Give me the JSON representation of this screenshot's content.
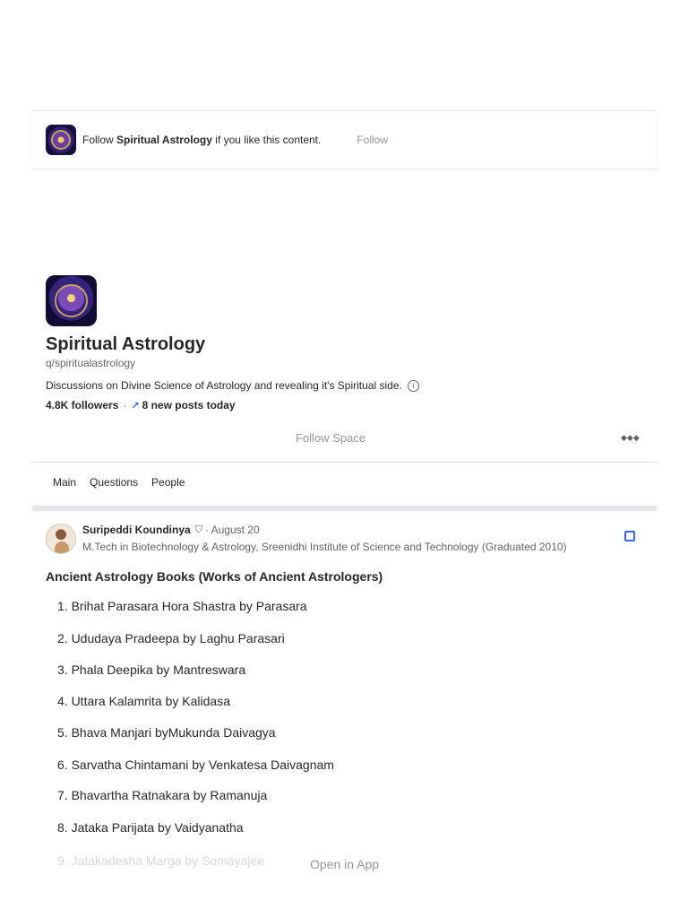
{
  "banner": {
    "prefix": "Follow",
    "space_name": "Spiritual Astrology",
    "suffix": "if you like this content.",
    "follow_label": "Follow"
  },
  "space": {
    "title": "Spiritual Astrology",
    "handle": "q/spiritualastrology",
    "description": "Discussions on Divine Science of Astrology and revealing it's Spiritual side.",
    "info_symbol": "i",
    "followers": "4.8K followers",
    "separator": "·",
    "new_posts": "8 new posts today",
    "follow_space_label": "Follow Space",
    "more_symbol": "◆◆◆"
  },
  "tabs": [
    "Main",
    "Questions",
    "People"
  ],
  "post": {
    "author": "Suripeddi Koundinya",
    "date_prefix": "· August 20",
    "credential": "M.Tech in Biotechnology & Astrology, Sreenidhi Institute of Science and Technology (Graduated 2010)",
    "title": "Ancient Astrology Books (Works of Ancient Astrologers)",
    "books": [
      "1. Brihat Parasara Hora Shastra by Parasara",
      "2. Ududaya Pradeepa by Laghu Parasari",
      "3. Phala Deepika by Mantreswara",
      "4. Uttara Kalamrita by Kalidasa",
      "5. Bhava Manjari byMukunda Daivagya",
      "6. Sarvatha Chintamani by Venkatesa Daivagnam",
      "7. Bhavartha Ratnakara by Ramanuja",
      "8. Jataka Parijata by Vaidyanatha",
      "9. Jatakadesha Marga by Somayajee"
    ]
  },
  "open_app_label": "Open in App",
  "colors": {
    "accent": "#2e69ff",
    "muted": "#939598",
    "text": "#282829"
  }
}
